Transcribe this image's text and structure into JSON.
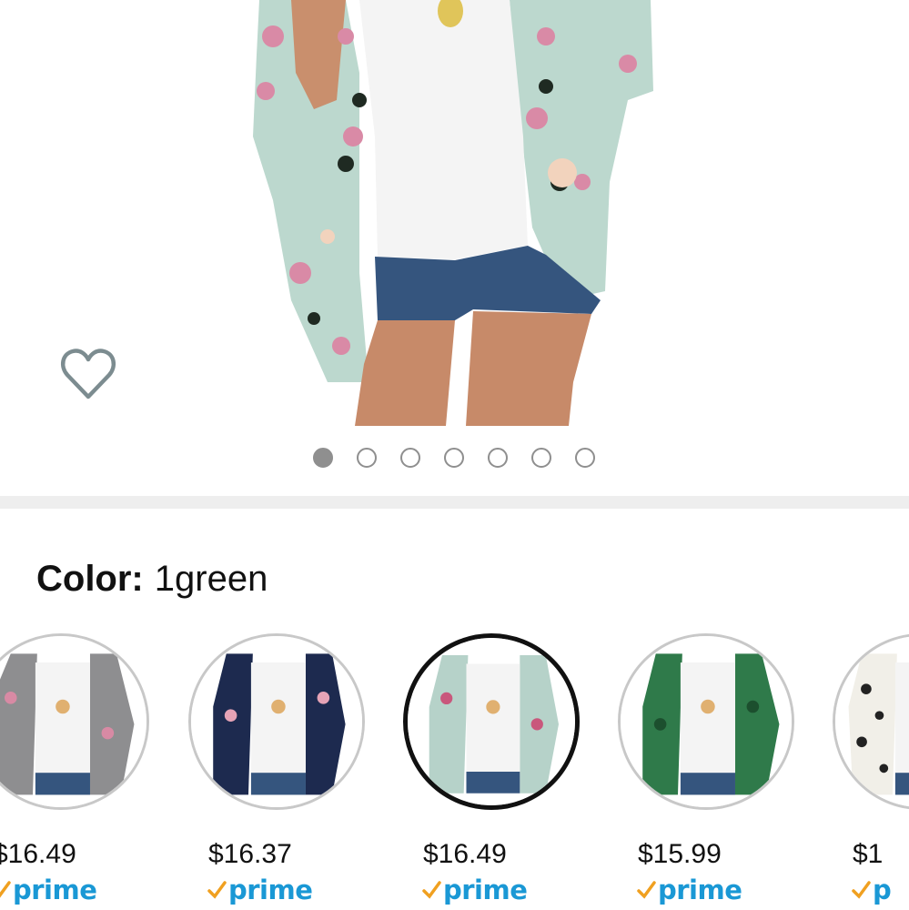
{
  "hero": {
    "image_icon": "product-photo",
    "favorite_icon": "heart-outline-icon"
  },
  "carousel": {
    "count": 7,
    "active_index": 0
  },
  "color": {
    "label": "Color:",
    "value": "1green"
  },
  "variants": [
    {
      "name": "gray-floral",
      "price": "$16.49",
      "prime": "prime",
      "fabric": "#8e8e90",
      "accent": "#d88aa4"
    },
    {
      "name": "navy-floral",
      "price": "$16.37",
      "prime": "prime",
      "fabric": "#1d2a4f",
      "accent": "#e6a3b6"
    },
    {
      "name": "green-floral",
      "price": "$16.49",
      "prime": "prime",
      "fabric": "#b6d2c9",
      "accent": "#c9577c"
    },
    {
      "name": "green-leaf",
      "price": "$15.99",
      "prime": "prime",
      "fabric": "#2f7a4a",
      "accent": "#1c4f2e"
    },
    {
      "name": "leopard",
      "price": "$1",
      "prime": "p",
      "fabric": "#f1efe8",
      "accent": "#222222"
    }
  ],
  "selected_variant": 2,
  "colors": {
    "prime_blue": "#1a98d5",
    "prime_check": "#f0a020",
    "dot_gray": "#8f8f8f",
    "heart_stroke": "#7c8c90"
  }
}
